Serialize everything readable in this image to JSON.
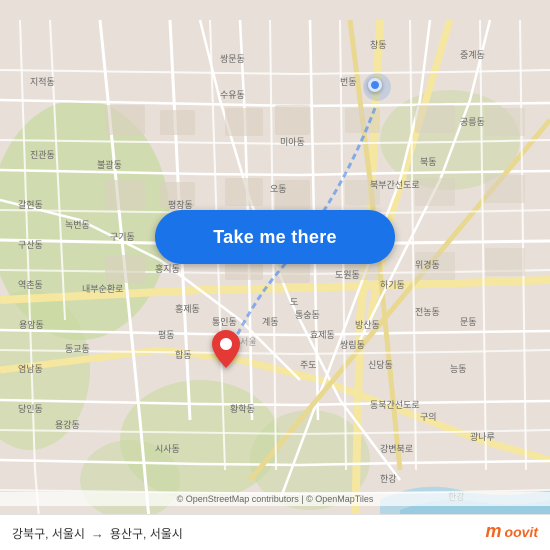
{
  "map": {
    "background_color": "#e8e0d8",
    "button_label": "Take me there",
    "button_color": "#1a73e8",
    "origin_label": "강북구, 서울시",
    "destination_label": "용산구, 서울시",
    "arrow_symbol": "→",
    "attribution": "© OpenStreetMap contributors | © OpenMapTiles",
    "logo_m": "m",
    "logo_text": "oovit",
    "blue_dot_title": "Origin location",
    "red_pin_title": "Destination location"
  }
}
